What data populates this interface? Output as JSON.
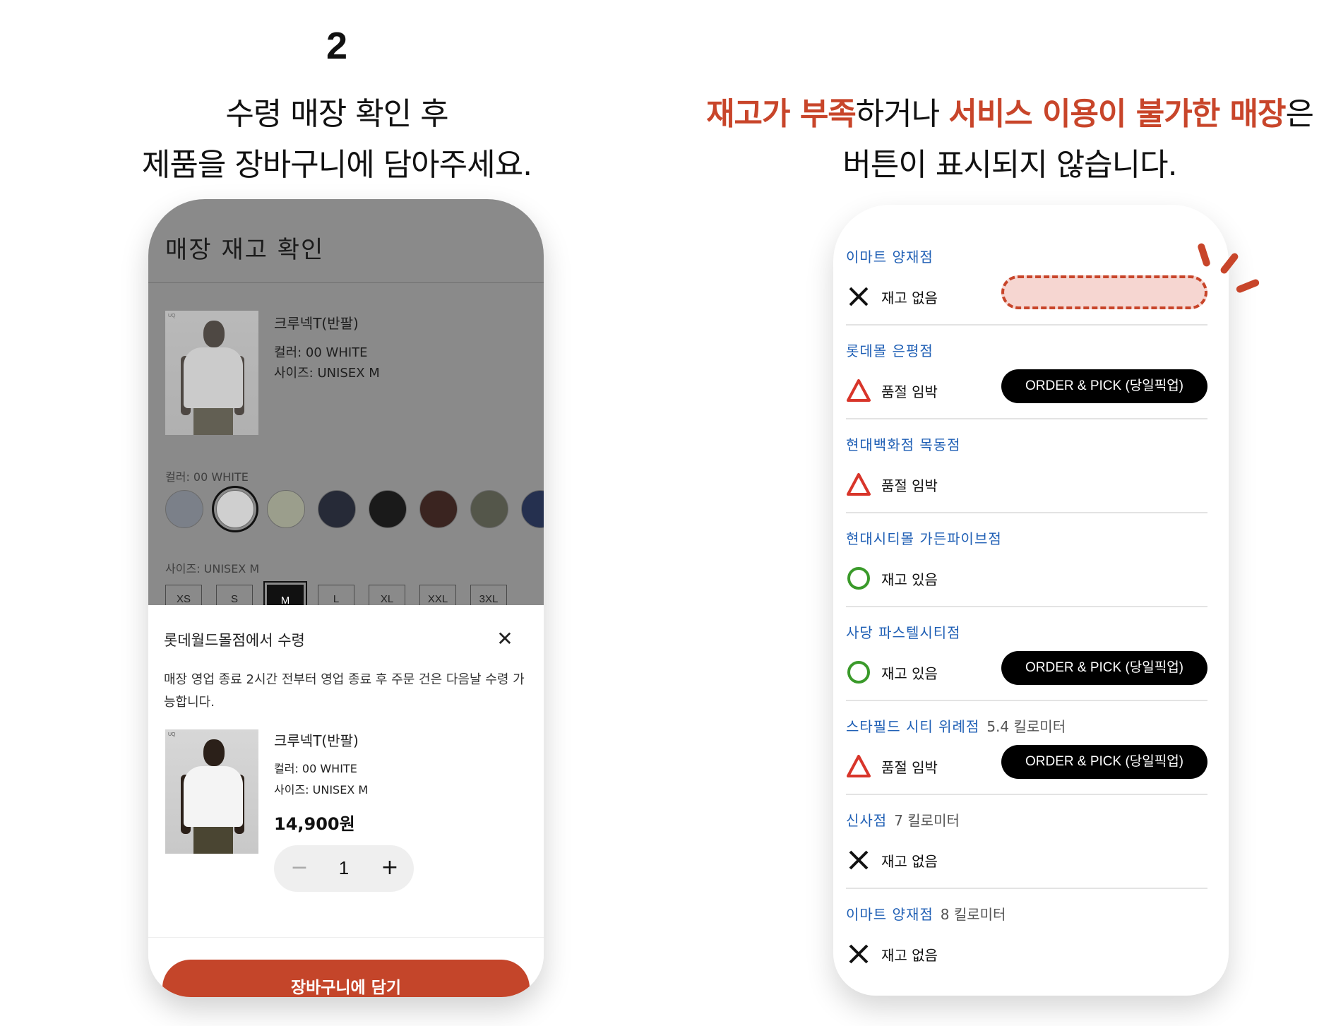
{
  "step_number": "2",
  "left_heading": {
    "line1": "수령 매장 확인 후",
    "line2": "제품을 장바구니에 담아주세요."
  },
  "right_heading": {
    "hl1": "재고가 부족",
    "mid": "하거나 ",
    "hl2": "서비스 이용이 불가한 매장",
    "tail": "은",
    "line2": "버튼이 표시되지 않습니다."
  },
  "colors": {
    "accent": "#c8452a",
    "store_link": "#1f5fb5",
    "in_stock": "#3a9a2a",
    "low_stock": "#d8352a"
  },
  "stock_modal": {
    "title": "매장 재고 확인",
    "product": {
      "name": "크루넥T(반팔)",
      "color": "컬러: 00 WHITE",
      "size": "사이즈: UNISEX M",
      "image_tag": "UQ"
    },
    "color_label": "컬러: 00 WHITE",
    "size_label": "사이즈: UNISEX M",
    "swatches": [
      "#7b8089",
      "#cfcfcf",
      "#9b9e8c",
      "#262a37",
      "#1a1a1a",
      "#3a2420",
      "#54564a",
      "#25304f"
    ],
    "sizes": [
      "XS",
      "S",
      "M",
      "L",
      "XL",
      "XXL",
      "3XL"
    ],
    "selected_size": "M"
  },
  "pickup_sheet": {
    "title": "롯데월드몰점에서 수령",
    "close_icon": "close-icon",
    "notice": "매장 영업 종료 2시간 전부터 영업 종료 후 주문 건은 다음날 수령 가능합니다.",
    "product": {
      "name": "크루넥T(반팔)",
      "color": "컬러: 00 WHITE",
      "size": "사이즈: UNISEX M",
      "price": "14,900원",
      "image_tag": "UQ"
    },
    "quantity": "1",
    "minus": "−",
    "plus": "+",
    "add_to_cart": "장바구니에 담기"
  },
  "stores": [
    {
      "name": "이마트 양재점",
      "distance": "",
      "status": "재고 없음",
      "icon": "x-icon",
      "button": ""
    },
    {
      "name": "롯데몰 은평점",
      "distance": "",
      "status": "품절 임박",
      "icon": "triangle-icon",
      "button": "ORDER & PICK (당일픽업)"
    },
    {
      "name": "현대백화점 목동점",
      "distance": "",
      "status": "품절 임박",
      "icon": "triangle-icon",
      "button": ""
    },
    {
      "name": "현대시티몰 가든파이브점",
      "distance": "",
      "status": "재고 있음",
      "icon": "circle-icon",
      "button": ""
    },
    {
      "name": "사당 파스텔시티점",
      "distance": "",
      "status": "재고 있음",
      "icon": "circle-icon",
      "button": "ORDER & PICK (당일픽업)"
    },
    {
      "name": "스타필드 시티 위례점",
      "distance": "5.4 킬로미터",
      "status": "품절 임박",
      "icon": "triangle-icon",
      "button": "ORDER & PICK (당일픽업)"
    },
    {
      "name": "신사점",
      "distance": "7 킬로미터",
      "status": "재고 없음",
      "icon": "x-icon",
      "button": ""
    },
    {
      "name": "이마트 양재점",
      "distance": "8 킬로미터",
      "status": "재고 없음",
      "icon": "x-icon",
      "button": ""
    }
  ]
}
